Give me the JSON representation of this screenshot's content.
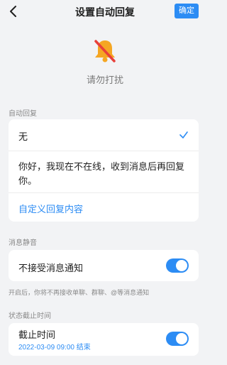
{
  "header": {
    "title": "设置自动回复",
    "confirm_label": "确定"
  },
  "hero": {
    "label": "请勿打扰"
  },
  "auto_reply": {
    "section_label": "自动回复",
    "option_none": "无",
    "option_message": "你好，我现在不在线，收到消息后再回复你。",
    "custom_link": "自定义回复内容"
  },
  "mute": {
    "section_label": "消息静音",
    "toggle_label": "不接受消息通知",
    "enabled": true,
    "helper_text": "开启后，你将不再接收单聊、群聊、@等消息通知"
  },
  "deadline": {
    "section_label": "状态截止时间",
    "toggle_label": "截止时间",
    "value": "2022-03-09 09:00 结束",
    "enabled": true
  },
  "colors": {
    "accent": "#2c8cf4",
    "background": "#f2f3f5",
    "bell": "#f5a623",
    "slash": "#e8403a"
  }
}
